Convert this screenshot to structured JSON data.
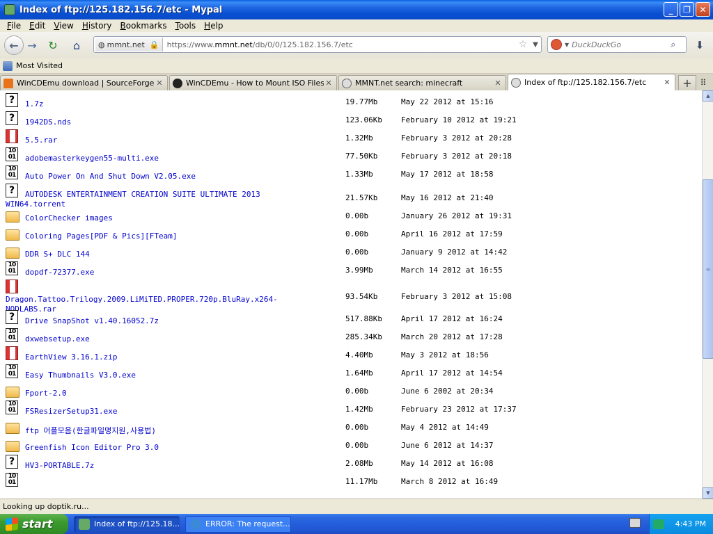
{
  "window": {
    "title": "Index of ftp://125.182.156.7/etc - Mypal"
  },
  "menu": [
    "File",
    "Edit",
    "View",
    "History",
    "Bookmarks",
    "Tools",
    "Help"
  ],
  "navbar": {
    "identity_label": "mmnt.net",
    "url_prefix": "https://www.",
    "url_domain": "mmnt.net",
    "url_path": "/db/0/0/125.182.156.7/etc",
    "search_placeholder": "DuckDuckGo"
  },
  "bookmarks": {
    "most_visited": "Most Visited"
  },
  "tabs": [
    {
      "label": "WinCDEmu download | SourceForge.net",
      "color": "#e8731a"
    },
    {
      "label": "WinCDEmu - How to Mount ISO Files",
      "color": "#222222"
    },
    {
      "label": "MMNT.net search: minecraft",
      "color": "#8a8a8a"
    },
    {
      "label": "Index of ftp://125.182.156.7/etc",
      "color": "#8a8a8a"
    }
  ],
  "files": [
    {
      "icon": "unknown",
      "name": "1.7z",
      "size": "19.77Mb",
      "date": "May 22 2012 at 15:16"
    },
    {
      "icon": "unknown",
      "name": "1942DS.nds",
      "size": "123.06Kb",
      "date": "February 10 2012 at 19:21"
    },
    {
      "icon": "rar",
      "name": "5.5.rar",
      "size": "1.32Mb",
      "date": "February 3 2012 at 20:28"
    },
    {
      "icon": "exe",
      "name": "adobemasterkeygen55-multi.exe",
      "size": "77.50Kb",
      "date": "February 3 2012 at 20:18"
    },
    {
      "icon": "exe",
      "name": "Auto Power On And Shut Down V2.05.exe",
      "size": "1.33Mb",
      "date": "May 17 2012 at 18:58"
    },
    {
      "icon": "unknown",
      "name": "AUTODESK ENTERTAINMENT CREATION SUITE ULTIMATE 2013",
      "name2": "WIN64.torrent",
      "size": "21.57Kb",
      "date": "May 16 2012 at 21:40"
    },
    {
      "icon": "folder",
      "name": "ColorChecker images",
      "size": "0.00b",
      "date": "January 26 2012 at 19:31"
    },
    {
      "icon": "folder",
      "name": "Coloring Pages[PDF & Pics][FTeam]",
      "size": "0.00b",
      "date": "April 16 2012 at 17:59"
    },
    {
      "icon": "folder",
      "name": "DDR S+ DLC 144",
      "size": "0.00b",
      "date": "January 9 2012 at 14:42"
    },
    {
      "icon": "exe",
      "name": "dopdf-72377.exe",
      "size": "3.99Mb",
      "date": "March 14 2012 at 16:55"
    },
    {
      "icon": "rar",
      "name": "Dragon.Tattoo.Trilogy.2009.LiMiTED.PROPER.720p.BluRay.x264-",
      "name2": "NODLABS.rar",
      "size": "93.54Kb",
      "date": "February 3 2012 at 15:08"
    },
    {
      "icon": "unknown",
      "name": "Drive SnapShot v1.40.16052.7z",
      "size": "517.88Kb",
      "date": "April 17 2012 at 16:24"
    },
    {
      "icon": "exe",
      "name": "dxwebsetup.exe",
      "size": "285.34Kb",
      "date": "March 20 2012 at 17:28"
    },
    {
      "icon": "rar",
      "name": "EarthView 3.16.1.zip",
      "size": "4.40Mb",
      "date": "May 3 2012 at 18:56"
    },
    {
      "icon": "exe",
      "name": "Easy Thumbnails V3.0.exe",
      "size": "1.64Mb",
      "date": "April 17 2012 at 14:54"
    },
    {
      "icon": "folder",
      "name": "Fport-2.0",
      "size": "0.00b",
      "date": "June 6 2002 at 20:34"
    },
    {
      "icon": "exe",
      "name": "FSResizerSetup31.exe",
      "size": "1.42Mb",
      "date": "February 23 2012 at 17:37"
    },
    {
      "icon": "folder",
      "name": "ftp 어플모음(한글파일명지원,사용법)",
      "size": "0.00b",
      "date": "May 4 2012 at 14:49"
    },
    {
      "icon": "folder",
      "name": "Greenfish Icon Editor Pro 3.0",
      "size": "0.00b",
      "date": "June 6 2012 at 14:37"
    },
    {
      "icon": "unknown",
      "name": "HV3-PORTABLE.7z",
      "size": "2.08Mb",
      "date": "May 14 2012 at 16:08"
    },
    {
      "icon": "exe",
      "name": "",
      "size": "11.17Mb",
      "date": "March 8 2012 at 16:49"
    }
  ],
  "status": {
    "text": "Looking up doptik.ru..."
  },
  "taskbar": {
    "start": "start",
    "tasks": [
      {
        "label": "Index of ftp://125.18...",
        "active": true
      },
      {
        "label": "ERROR: The request...",
        "active": false
      }
    ],
    "clock": "4:43 PM"
  }
}
